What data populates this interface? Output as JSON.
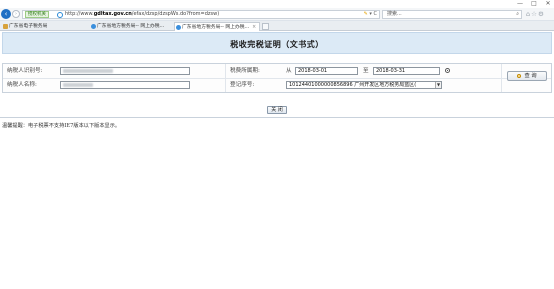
{
  "window": {
    "minimize": "—",
    "maximize": "□",
    "close": "✕"
  },
  "navbar": {
    "secure_badge": "授权机关",
    "url_prefix": "http://www.",
    "url_domain": "gdltax.gov.cn",
    "url_path": "/efax/dzsp/dzspWs.do?from=dzsw)",
    "addr_tools": "▾ C",
    "search_value": "搜索...",
    "search_icon": "⌕",
    "toolbar_icons": "⌂☆⚙"
  },
  "tabs": [
    {
      "label": "广东省电子税务局"
    },
    {
      "label": "广东省地方税务局-- 网上办税..."
    },
    {
      "label": "广东省地方税务局-- 网上办税..."
    }
  ],
  "page": {
    "title": "税收完税证明（文书式）",
    "form": {
      "taxpayer_id_label": "纳税人识别号:",
      "taxpayer_name_label": "纳税人名称:",
      "tax_period_label": "税费所属期:",
      "from_label": "从",
      "to_label": "至",
      "date_from": "2018-03-01",
      "date_to": "2018-03-31",
      "registration_label": "登记序号:",
      "registration_value": "10124401000000856896  广州开发区地方税务局蓝区(",
      "query_button": "查 询"
    },
    "close_button": "关 闭",
    "tip": "温馨提醒：电子税票不支持IE7版本以下版本显示。"
  },
  "colors": {
    "title_bg": "#dceaf6",
    "accent": "#1f6fc4"
  }
}
